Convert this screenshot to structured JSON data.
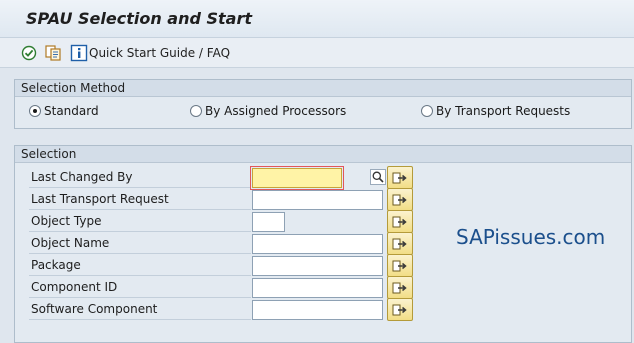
{
  "window": {
    "title": "SPAU Selection and Start"
  },
  "toolbar": {
    "items": [
      {
        "icon": "execute-icon"
      },
      {
        "icon": "copy-variant-icon"
      },
      {
        "icon": "info-icon",
        "label": "Quick Start Guide / FAQ"
      }
    ]
  },
  "selection_method": {
    "header": "Selection Method",
    "options": [
      {
        "label": "Standard",
        "selected": true
      },
      {
        "label": "By Assigned Processors",
        "selected": false
      },
      {
        "label": "By Transport Requests",
        "selected": false
      }
    ]
  },
  "selection": {
    "header": "Selection",
    "fields": [
      {
        "label": "Last Changed By",
        "value": "",
        "has_match_help": true
      },
      {
        "label": "Last Transport Request",
        "value": ""
      },
      {
        "label": "Object Type",
        "value": ""
      },
      {
        "label": "Object Name",
        "value": ""
      },
      {
        "label": "Package",
        "value": ""
      },
      {
        "label": "Component ID",
        "value": ""
      },
      {
        "label": "Software Component",
        "value": ""
      }
    ],
    "multiple_selection_icon": "arrow-right-icon"
  },
  "watermark": "SAPissues.com",
  "colors": {
    "focused_field": "#fff3a6",
    "arrow_button": "#f2de86",
    "watermark": "#1b4f8c"
  }
}
